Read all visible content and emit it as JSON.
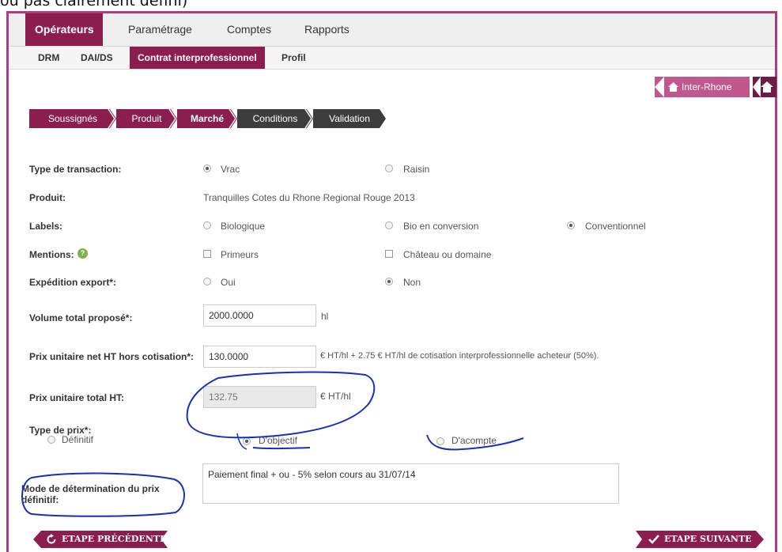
{
  "caption": "ou pas clairement défini)",
  "nav_primary": [
    {
      "label": "Opérateurs",
      "active": true
    },
    {
      "label": "Paramétrage",
      "active": false
    },
    {
      "label": "Comptes",
      "active": false
    },
    {
      "label": "Rapports",
      "active": false
    }
  ],
  "nav_secondary": [
    {
      "label": "DRM",
      "active": false
    },
    {
      "label": "DAI/DS",
      "active": false
    },
    {
      "label": "Contrat interprofessionnel",
      "active": true
    },
    {
      "label": "Profil",
      "active": false
    }
  ],
  "interprofession": {
    "label": "Inter-Rhone"
  },
  "steps": [
    {
      "label": "Soussignés",
      "state": "done"
    },
    {
      "label": "Produit",
      "state": "done"
    },
    {
      "label": "Marché",
      "state": "current"
    },
    {
      "label": "Conditions",
      "state": "todo"
    },
    {
      "label": "Validation",
      "state": "todo"
    }
  ],
  "form": {
    "transaction": {
      "label": "Type de transaction:",
      "options": [
        {
          "label": "Vrac",
          "checked": true
        },
        {
          "label": "Raisin",
          "checked": false
        }
      ]
    },
    "produit": {
      "label": "Produit:",
      "value": "Tranquilles Cotes du Rhone Regional Rouge 2013"
    },
    "labels": {
      "label": "Labels:",
      "options": [
        {
          "label": "Biologique",
          "checked": false
        },
        {
          "label": "Bio en conversion",
          "checked": false
        },
        {
          "label": "Conventionnel",
          "checked": true
        }
      ]
    },
    "mentions": {
      "label": "Mentions:",
      "help": "?",
      "options": [
        {
          "label": "Primeurs",
          "checked": false
        },
        {
          "label": "Château ou domaine",
          "checked": false
        }
      ]
    },
    "export": {
      "label": "Expédition export*:",
      "options": [
        {
          "label": "Oui",
          "checked": false
        },
        {
          "label": "Non",
          "checked": true
        }
      ]
    },
    "volume": {
      "label": "Volume total proposé*:",
      "value": "2000.0000",
      "unit": "hl"
    },
    "prix_net": {
      "label": "Prix unitaire net HT hors cotisation*:",
      "value": "130.0000",
      "note": "€ HT/hl + 2.75 € HT/hl de cotisation interprofessionnelle acheteur (50%)."
    },
    "prix_total": {
      "label": "Prix unitaire total HT:",
      "value": "132.75",
      "unit": "€ HT/hl"
    },
    "type_prix": {
      "label": "Type de prix*:",
      "options": [
        {
          "label": "Définitif",
          "checked": false
        },
        {
          "label": "D'objectif",
          "checked": true
        },
        {
          "label": "D'acompte",
          "checked": false
        }
      ]
    },
    "mode": {
      "label": "Mode de détermination du prix définitif:",
      "value": "Paiement final + ou - 5% selon cours au 31/07/14"
    }
  },
  "buttons": {
    "prev": "ETAPE PRÉCÉDENTE",
    "next": "ETAPE SUIVANTE"
  },
  "colors": {
    "brand": "#8c1d4f",
    "brand_light": "#c0588e",
    "step_done": "#8c1d4f",
    "step_todo": "#3d3d3d",
    "annotation": "#1a2fb8"
  }
}
